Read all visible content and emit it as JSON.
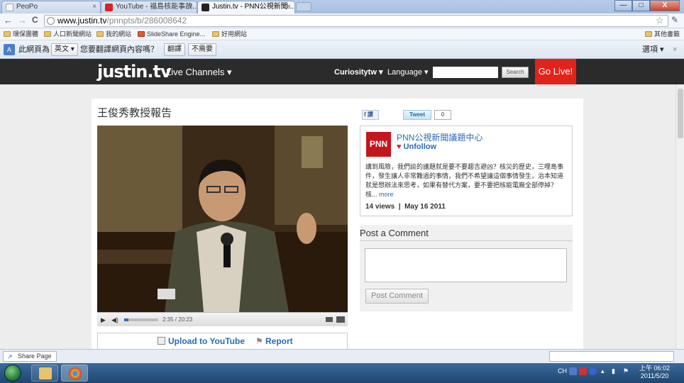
{
  "browser": {
    "tabs": [
      {
        "label": "PeoPo",
        "active": false
      },
      {
        "label": "YouTube - 福島核能事故...",
        "active": false
      },
      {
        "label": "Justin.tv - PNN公視新聞...",
        "active": true
      }
    ],
    "window_buttons": {
      "minimize": "—",
      "maximize": "□",
      "close": "X"
    },
    "nav": {
      "back": "←",
      "forward": "→",
      "reload": "C"
    },
    "url_host": "www.justin.tv",
    "url_path": "/pnnpts/b/286008642",
    "bookmarks": [
      "環保團體",
      "人口新聞網站",
      "我的網站",
      "SlideShare Engine...",
      "好用網站"
    ],
    "bookmarks_other": "其他書籤",
    "translate_bar": {
      "prefix": "此網頁為",
      "language": "英文",
      "question": "您要翻譯網頁內容嗎？",
      "translate_button": "翻譯",
      "no_button": "不需要",
      "options": "選項",
      "close": "×"
    }
  },
  "site_header": {
    "logo": "justin.tv",
    "live_channels": "Live Channels ▾",
    "username": "Curiositytw ▾",
    "language": "Language ▾",
    "search_button": "Search",
    "go_live": "Go Live!"
  },
  "video_page": {
    "title": "王俊秀教授報告",
    "player": {
      "time": "2:35 / 20:23",
      "progress": 0.128
    },
    "upload_link": "Upload to YouTube",
    "report_link": "Report"
  },
  "share": {
    "facebook": "f 讚",
    "tweet": "Tweet",
    "tweet_count": "0"
  },
  "channel": {
    "logo_text": "PNN",
    "name": "PNN公視新聞議題中心",
    "unfollow": "Unfollow",
    "description": "講到風險，我們談的議題就是要不要趨吉避凶？核災的歷史，三哩島事件，發生讓人非常難過的事情，我們不希望讓這個事情發生，治本知道就是想辦法來思考，如果有替代方案，要不要把核能電廠全部停掉？ 核...",
    "more": "more",
    "views": "14 views",
    "date": "May 16 2011"
  },
  "comments": {
    "heading": "Post a Comment",
    "post_button": "Post Comment"
  },
  "status_shelf": {
    "share_page": "Share Page"
  },
  "taskbar": {
    "tray_lang": "CH",
    "clock_time": "上午 06:02",
    "clock_date": "2011/5/20"
  }
}
